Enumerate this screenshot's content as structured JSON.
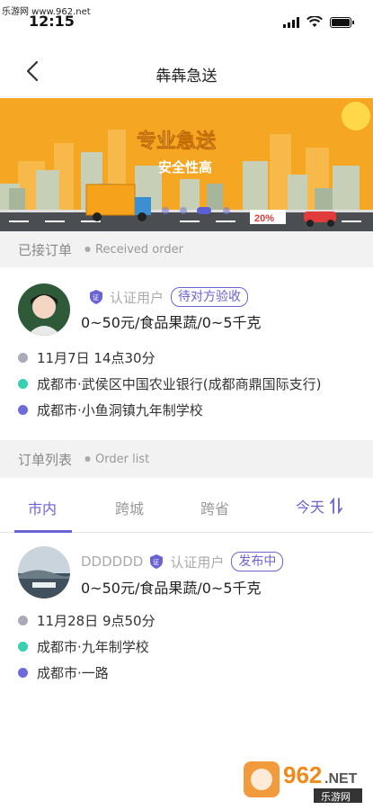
{
  "watermark": {
    "top_text": "乐游网 www.962.net",
    "logo_main": "962",
    "logo_suffix": ".NET",
    "logo_sub": "乐游网"
  },
  "status_bar": {
    "time": "12:15"
  },
  "nav": {
    "title": "犇犇急送"
  },
  "banner": {
    "line1": "专业急送",
    "line2": "安全性高",
    "sale_tag": "20%"
  },
  "received": {
    "heading_cn": "已接订单",
    "heading_en": "Received order",
    "order": {
      "verified_label": "认证用户",
      "shield_char": "证",
      "status": "待对方验收",
      "cargo": "0~50元/食品果蔬/0~5千克",
      "time": "11月7日 14点30分",
      "from": "成都市·武侯区中国农业银行(成都商鼎国际支行)",
      "to": "成都市·小鱼洞镇九年制学校"
    }
  },
  "order_list": {
    "heading_cn": "订单列表",
    "heading_en": "Order list",
    "tabs": [
      "市内",
      "跨城",
      "跨省"
    ],
    "active_tab": 0,
    "sort_label": "今天",
    "order": {
      "username": "DDDDDD",
      "verified_label": "认证用户",
      "shield_char": "证",
      "status": "发布中",
      "cargo": "0~50元/食品果蔬/0~5千克",
      "time": "11月28日 9点50分",
      "from": "成都市·九年制学校",
      "to": "成都市·一路"
    }
  },
  "colors": {
    "accent": "#6a63d4",
    "time_dot": "#a9acb8",
    "from_dot": "#37d0b0",
    "to_dot": "#6f6bdb",
    "banner_bg": "#f5a623"
  }
}
